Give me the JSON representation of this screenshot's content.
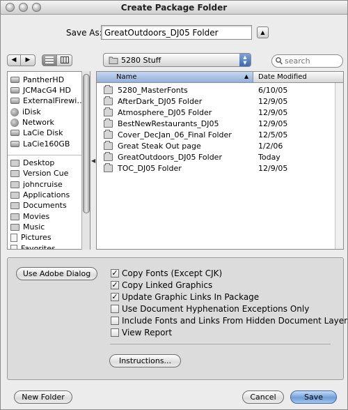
{
  "window": {
    "title": "Create Package Folder"
  },
  "save_as": {
    "label": "Save As:",
    "value": "GreatOutdoors_DJ05 Folder"
  },
  "toolbar": {
    "location": "5280 Stuff",
    "search_placeholder": "search",
    "back_glyph": "◀",
    "forward_glyph": "▶"
  },
  "sidebar": {
    "items": [
      {
        "label": "PantherHD",
        "icon": "disk-icon"
      },
      {
        "label": "JCMacG4 HD",
        "icon": "disk-icon"
      },
      {
        "label": "ExternalFirewi…",
        "icon": "disk-icon"
      },
      {
        "label": "iDisk",
        "icon": "idisk-icon"
      },
      {
        "label": "Network",
        "icon": "network-icon"
      },
      {
        "label": "LaCie Disk",
        "icon": "disk-icon"
      },
      {
        "label": "LaCie160GB",
        "icon": "disk-icon"
      },
      {
        "label": "Desktop",
        "icon": "desktop-icon"
      },
      {
        "label": "Version Cue",
        "icon": "folder-icon"
      },
      {
        "label": "johncruise",
        "icon": "home-icon"
      },
      {
        "label": "Applications",
        "icon": "applications-icon"
      },
      {
        "label": "Documents",
        "icon": "folder-icon"
      },
      {
        "label": "Movies",
        "icon": "movies-icon"
      },
      {
        "label": "Music",
        "icon": "music-icon"
      },
      {
        "label": "Pictures",
        "icon": "pictures-icon"
      },
      {
        "label": "Favorites",
        "icon": "favorites-icon"
      }
    ]
  },
  "file_list": {
    "columns": {
      "name": "Name",
      "date": "Date Modified"
    },
    "rows": [
      {
        "name": "5280_MasterFonts",
        "date": "6/10/05"
      },
      {
        "name": "AfterDark_DJ05 Folder",
        "date": "12/9/05"
      },
      {
        "name": "Atmosphere_DJ05 Folder",
        "date": "12/9/05"
      },
      {
        "name": "BestNewRestaurants_DJ05",
        "date": "12/9/05"
      },
      {
        "name": "Cover_DecJan_06_Final Folder",
        "date": "12/5/05"
      },
      {
        "name": "Great Steak Out page",
        "date": "1/2/06"
      },
      {
        "name": "GreatOutdoors_DJ05 Folder",
        "date": "Today"
      },
      {
        "name": "TOC_DJ05 Folder",
        "date": "12/9/05"
      }
    ]
  },
  "options": {
    "adobe_dialog_button": "Use Adobe Dialog",
    "checkboxes": [
      {
        "label": "Copy Fonts (Except CJK)",
        "checked": true
      },
      {
        "label": "Copy Linked Graphics",
        "checked": true
      },
      {
        "label": "Update Graphic Links In Package",
        "checked": true
      },
      {
        "label": "Use Document Hyphenation Exceptions Only",
        "checked": false
      },
      {
        "label": "Include Fonts and Links From Hidden Document Layers",
        "checked": false
      },
      {
        "label": "View Report",
        "checked": false
      }
    ],
    "instructions_button": "Instructions..."
  },
  "footer": {
    "new_folder": "New Folder",
    "cancel": "Cancel",
    "save": "Save"
  },
  "colors": {
    "accent": "#6e9ed8",
    "window_bg": "#ececec"
  }
}
